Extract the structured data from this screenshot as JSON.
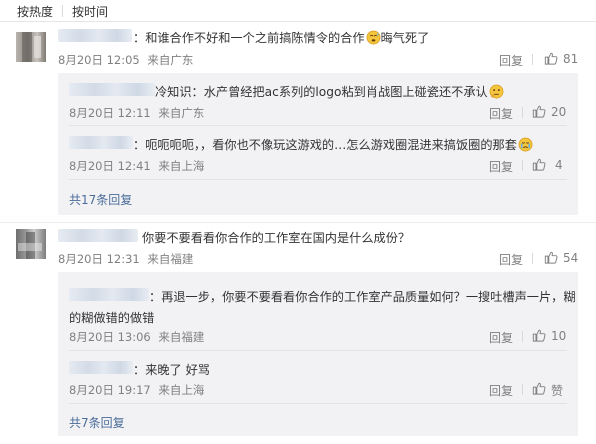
{
  "sort_bar": {
    "hot": "按热度",
    "time": "按时间"
  },
  "comments": [
    {
      "text": "和谁合作不好和一个之前搞陈情令的合作",
      "text_tail": "晦气死了",
      "time": "8月20日 12:05",
      "location": "来自广东",
      "reply_label": "回复",
      "likes": "81",
      "replies": [
        {
          "text": "冷知识：水产曾经把ac系列的logo粘到肖战图上碰瓷还不承认",
          "time": "8月20日 12:11",
          "location": "来自广东",
          "reply_label": "回复",
          "likes": "20"
        },
        {
          "text": "呃呃呃呃，，看你也不像玩这游戏的…怎么游戏圈混进来搞饭圈的那套",
          "time": "8月20日 12:41",
          "location": "来自上海",
          "reply_label": "回复",
          "likes": "4"
        }
      ],
      "more": "共17条回复"
    },
    {
      "text": "你要不要看看你合作的工作室在国内是什么成份？",
      "time": "8月20日 12:31",
      "location": "来自福建",
      "reply_label": "回复",
      "likes": "54",
      "replies": [
        {
          "text_line1": "再退一步，你要不要看看你合作的工作室产品质量如何？一搜吐槽声一片，糊",
          "text_line2": "的糊做错的做错",
          "time": "8月20日 13:06",
          "location": "来自福建",
          "reply_label": "回复",
          "likes": "10"
        },
        {
          "text": "来晚了 好骂",
          "time": "8月20日 19:17",
          "location": "来自上海",
          "reply_label": "回复",
          "likes": "赞"
        }
      ],
      "more": "共7条回复"
    }
  ],
  "colors": {
    "link": "#4a6d9a",
    "meta": "#808080",
    "text": "#333333",
    "sub_bg": "#f2f2f5"
  },
  "icons": [
    "thumbs-up-icon",
    "sweat-emoji-icon",
    "thinking-emoji-icon",
    "crying-emoji-icon"
  ]
}
